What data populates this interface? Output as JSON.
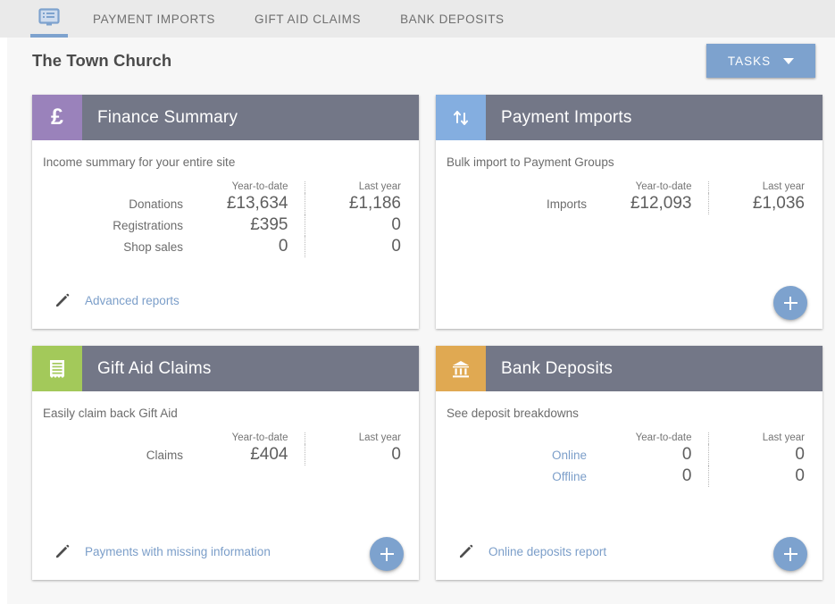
{
  "tabs": [
    {
      "id": "dashboard",
      "label": "",
      "icon": "dashboard-icon",
      "active": true
    },
    {
      "id": "payment-imports",
      "label": "PAYMENT IMPORTS",
      "icon": "",
      "active": false
    },
    {
      "id": "gift-aid-claims",
      "label": "GIFT AID CLAIMS",
      "icon": "",
      "active": false
    },
    {
      "id": "bank-deposits",
      "label": "BANK DEPOSITS",
      "icon": "",
      "active": false
    }
  ],
  "header": {
    "title": "The Town Church",
    "tasks_label": "TASKS"
  },
  "columns": {
    "ytd": "Year-to-date",
    "last_year": "Last year"
  },
  "cards": [
    {
      "id": "finance-summary",
      "title": "Finance Summary",
      "subtitle": "Income summary for your entire site",
      "badge_icon": "pound-icon",
      "badge_color": "#9a82bb",
      "rows": [
        {
          "label": "Donations",
          "link": false,
          "ytd": "£13,634",
          "last_year": "£1,186"
        },
        {
          "label": "Registrations",
          "link": false,
          "ytd": "£395",
          "last_year": "0"
        },
        {
          "label": "Shop sales",
          "link": false,
          "ytd": "0",
          "last_year": "0"
        }
      ],
      "link": {
        "label": "Advanced reports",
        "icon": "pencil-icon"
      },
      "fab": false
    },
    {
      "id": "payment-imports",
      "title": "Payment Imports",
      "subtitle": "Bulk import to Payment Groups",
      "badge_icon": "sort-arrows-icon",
      "badge_color": "#84aee0",
      "rows": [
        {
          "label": "Imports",
          "link": false,
          "ytd": "£12,093",
          "last_year": "£1,036"
        }
      ],
      "link": null,
      "fab": true,
      "fab_label": "+"
    },
    {
      "id": "gift-aid-claims",
      "title": "Gift Aid Claims",
      "subtitle": "Easily claim back Gift Aid",
      "badge_icon": "receipt-icon",
      "badge_color": "#9fc council",
      "rows": [
        {
          "label": "Claims",
          "link": false,
          "ytd": "£404",
          "last_year": "0"
        }
      ],
      "link": {
        "label": "Payments with missing information",
        "icon": "pencil-icon"
      },
      "fab": true,
      "fab_label": "+"
    },
    {
      "id": "bank-deposits",
      "title": "Bank Deposits",
      "subtitle": "See deposit breakdowns",
      "badge_icon": "bank-icon",
      "badge_color": "#e0a952",
      "rows": [
        {
          "label": "Online",
          "link": true,
          "ytd": "0",
          "last_year": "0"
        },
        {
          "label": "Offline",
          "link": true,
          "ytd": "0",
          "last_year": "0"
        }
      ],
      "link": {
        "label": "Online deposits report",
        "icon": "pencil-icon"
      },
      "fab": true,
      "fab_label": "+"
    }
  ],
  "colors": {
    "accent_blue": "#7da2ce",
    "card_header": "#737787",
    "link_blue": "#7b9ec9",
    "badge_finance": "#9a82bb",
    "badge_imports": "#84aee0",
    "badge_giftaid": "#a3c council",
    "badge_bank": "#e0a952",
    "page_bg": "#f7f7f7",
    "tabbar_bg": "#eaeaea"
  }
}
